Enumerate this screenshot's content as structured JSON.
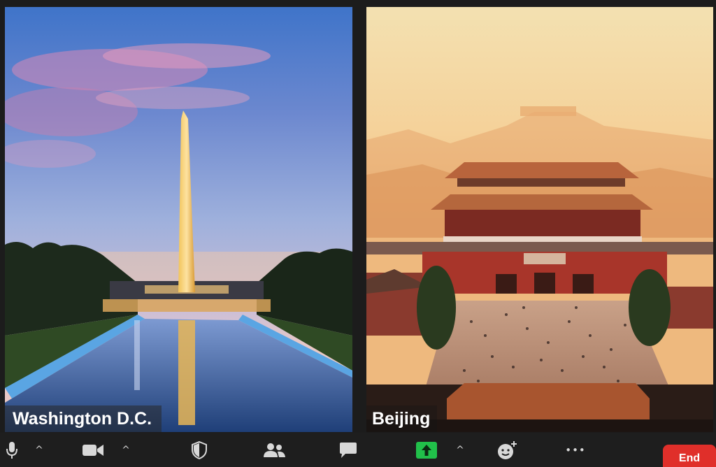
{
  "participants": [
    {
      "label": "Washington D.C."
    },
    {
      "label": "Beijing"
    }
  ],
  "toolbar": {
    "end_label": "End",
    "more_label": "•••",
    "caret": "^",
    "icons": [
      "microphone-icon",
      "video-camera-icon",
      "shield-icon",
      "participants-icon",
      "chat-icon",
      "share-screen-icon",
      "reactions-icon",
      "more-icon"
    ],
    "share_color": "#21c04a",
    "end_color": "#e02f2a"
  }
}
